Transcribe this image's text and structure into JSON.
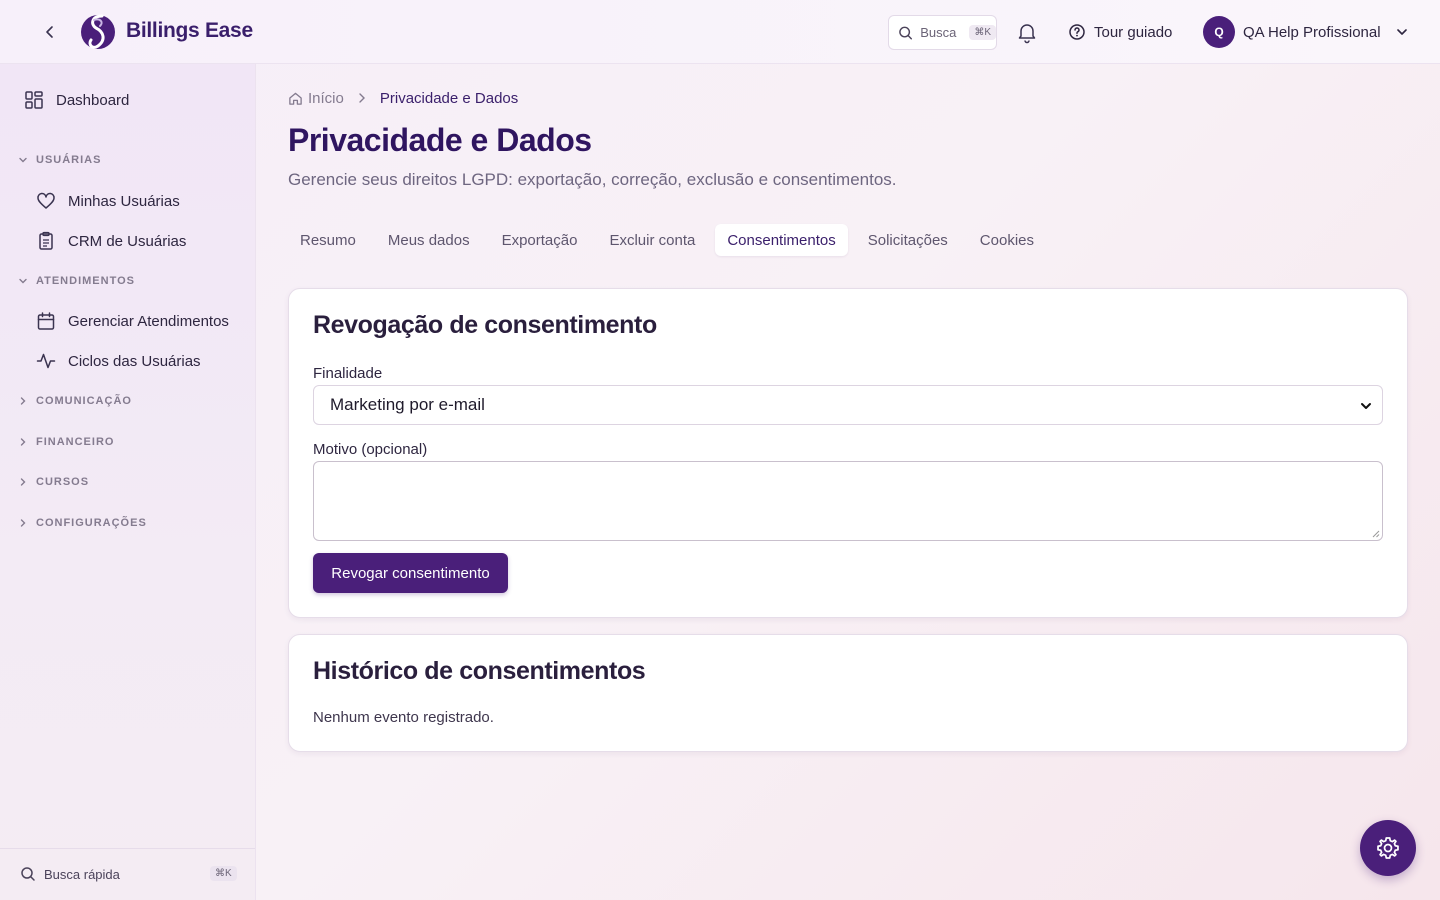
{
  "header": {
    "brand": "Billings Ease",
    "search_label": "Busca",
    "search_kbd": "⌘K",
    "tour_label": "Tour guiado",
    "user_initial": "Q",
    "user_name": "QA Help Profissional"
  },
  "sidebar": {
    "dashboard": "Dashboard",
    "groups": [
      {
        "label": "USUÁRIAS",
        "items": [
          "Minhas Usuárias",
          "CRM de Usuárias"
        ]
      },
      {
        "label": "ATENDIMENTOS",
        "items": [
          "Gerenciar Atendimentos",
          "Ciclos das Usuárias"
        ]
      },
      {
        "label": "COMUNICAÇÃO"
      },
      {
        "label": "FINANCEIRO"
      },
      {
        "label": "CURSOS"
      },
      {
        "label": "CONFIGURAÇÕES"
      }
    ],
    "quick_search": "Busca rápida",
    "quick_kbd": "⌘K"
  },
  "breadcrumb": {
    "home": "Início",
    "current": "Privacidade e Dados"
  },
  "page": {
    "title": "Privacidade e Dados",
    "subtitle": "Gerencie seus direitos LGPD: exportação, correção, exclusão e consentimentos."
  },
  "tabs": [
    "Resumo",
    "Meus dados",
    "Exportação",
    "Excluir conta",
    "Consentimentos",
    "Solicitações",
    "Cookies"
  ],
  "revocation": {
    "title": "Revogação de consentimento",
    "purpose_label": "Finalidade",
    "purpose_value": "Marketing por e-mail",
    "reason_label": "Motivo (opcional)",
    "reason_value": "",
    "submit": "Revogar consentimento"
  },
  "history": {
    "title": "Histórico de consentimentos",
    "empty": "Nenhum evento registrado."
  },
  "colors": {
    "primary": "#4a1f7a",
    "title": "#2f1560"
  }
}
